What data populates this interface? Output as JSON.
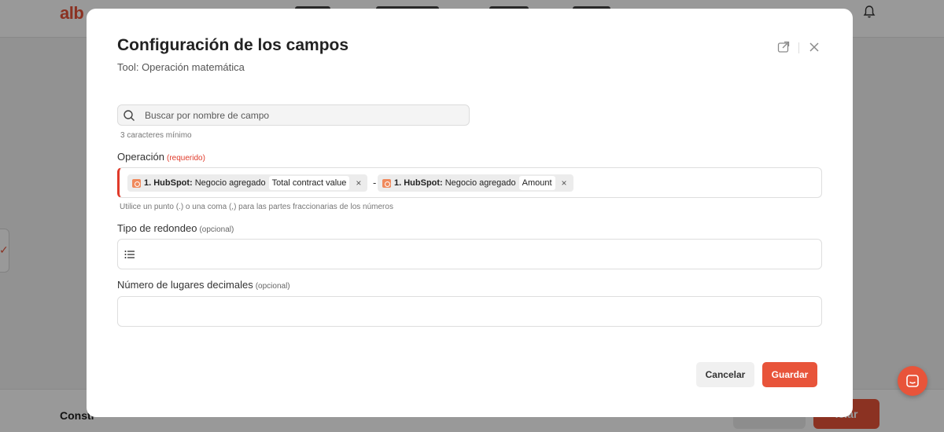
{
  "background": {
    "logo": "alb",
    "bottom_left_label": "Constr",
    "bottom_right_button": "iciar"
  },
  "modal": {
    "title": "Configuración de los campos",
    "subtitle": "Tool: Operación matemática",
    "icons": {
      "export": "export-icon",
      "close": "close-icon"
    },
    "search": {
      "placeholder": "Buscar por nombre de campo",
      "value": "",
      "hint": "3 caracteres mínimo"
    },
    "operation": {
      "label": "Operación",
      "required_tag": "(requerido)",
      "tokens": [
        {
          "source": "1. HubSpot:",
          "event": "Negocio agregado",
          "value": "Total contract value",
          "remove": "×"
        },
        {
          "source": "1. HubSpot:",
          "event": "Negocio agregado",
          "value": "Amount",
          "remove": "×"
        }
      ],
      "operator": "-",
      "hint": "Utilice un punto (.) o una coma (,) para las partes fraccionarias de los números"
    },
    "rounding": {
      "label": "Tipo de redondeo",
      "optional_tag": "(opcional)",
      "value": "",
      "icon": "list-icon"
    },
    "decimals": {
      "label": "Número de lugares decimales",
      "optional_tag": "(opcional)",
      "value": ""
    },
    "buttons": {
      "cancel": "Cancelar",
      "save": "Guardar"
    }
  },
  "colors": {
    "accent": "#e8543a",
    "required": "#e03a2a",
    "overlay": "rgba(0,0,0,0.40)"
  }
}
